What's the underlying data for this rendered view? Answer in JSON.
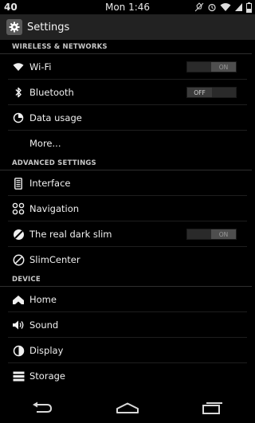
{
  "statusbar": {
    "battery_level": "40",
    "time": "Mon 1:46",
    "icons": [
      "no-notifications-icon",
      "alarm-icon",
      "wifi-signal-icon",
      "cell-signal-icon",
      "battery-icon"
    ]
  },
  "actionbar": {
    "icon": "gear-icon",
    "title": "Settings"
  },
  "sections": {
    "wireless": {
      "header": "WIRELESS & NETWORKS",
      "wifi": {
        "label": "Wi-Fi",
        "toggle": "ON",
        "icon": "wifi-icon"
      },
      "bluetooth": {
        "label": "Bluetooth",
        "toggle": "OFF",
        "icon": "bluetooth-icon"
      },
      "data_usage": {
        "label": "Data usage",
        "icon": "data-usage-icon"
      },
      "more": {
        "label": "More..."
      }
    },
    "advanced": {
      "header": "ADVANCED SETTINGS",
      "interface": {
        "label": "Interface",
        "icon": "interface-icon"
      },
      "navigation": {
        "label": "Navigation",
        "icon": "navigation-icon"
      },
      "dark_slim": {
        "label": "The real dark slim",
        "toggle": "ON",
        "icon": "dark-slim-icon"
      },
      "slimcenter": {
        "label": "SlimCenter",
        "icon": "slimcenter-icon"
      }
    },
    "device": {
      "header": "DEVICE",
      "home": {
        "label": "Home",
        "icon": "home-icon"
      },
      "sound": {
        "label": "Sound",
        "icon": "sound-icon"
      },
      "display": {
        "label": "Display",
        "icon": "display-icon"
      },
      "storage": {
        "label": "Storage",
        "icon": "storage-icon"
      }
    }
  },
  "navbar": {
    "buttons": [
      "back-icon",
      "home-nav-icon",
      "recents-icon"
    ]
  }
}
